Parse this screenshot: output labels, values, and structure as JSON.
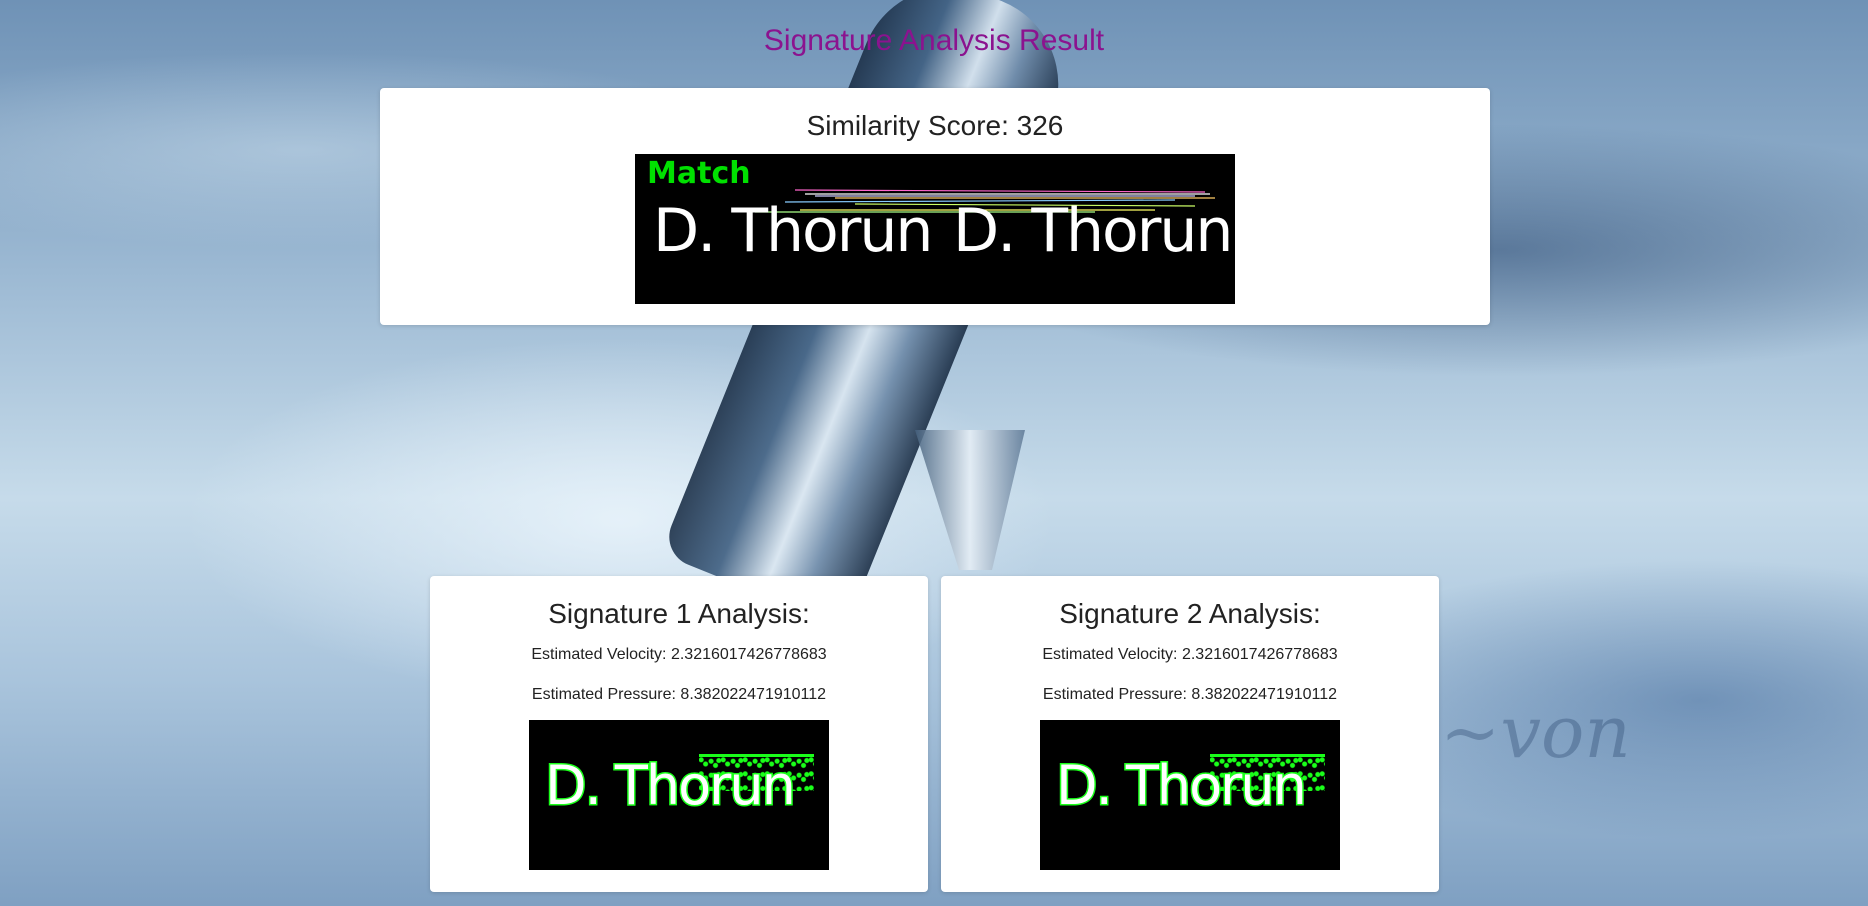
{
  "page": {
    "title": "Signature Analysis Result",
    "title_color": "#8b138f"
  },
  "comparison": {
    "score_label": "Similarity Score: 326",
    "match_label": "Match",
    "match_color": "#00e000",
    "signature_text": "D. Thorun"
  },
  "signatures": [
    {
      "heading": "Signature 1 Analysis:",
      "velocity": "Estimated Velocity: 2.3216017426778683",
      "pressure": "Estimated Pressure: 8.382022471910112",
      "signature_text": "D. Thorun"
    },
    {
      "heading": "Signature 2 Analysis:",
      "velocity": "Estimated Velocity: 2.3216017426778683",
      "pressure": "Estimated Pressure: 8.382022471910112",
      "signature_text": "D. Thorun"
    }
  ]
}
